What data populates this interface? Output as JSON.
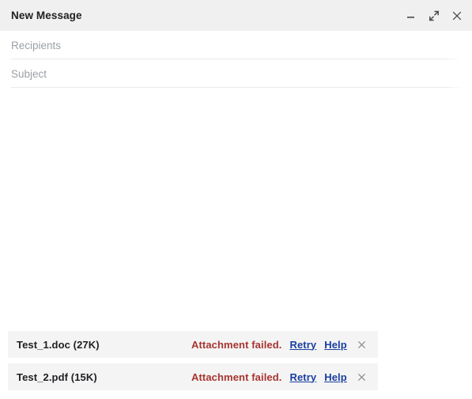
{
  "window": {
    "title": "New Message",
    "controls": [
      {
        "name": "minimize",
        "icon": "minimize-icon",
        "label": "Minimize"
      },
      {
        "name": "popout",
        "icon": "expand-icon",
        "label": "Full screen"
      },
      {
        "name": "close",
        "icon": "close-icon",
        "label": "Save & close"
      }
    ]
  },
  "fields": {
    "recipients": {
      "placeholder": "Recipients",
      "value": ""
    },
    "subject": {
      "placeholder": "Subject",
      "value": ""
    }
  },
  "body": {
    "placeholder": "",
    "value": ""
  },
  "attachments": {
    "items": [
      {
        "filename": "Test_1.doc (27K)",
        "status": "Attachment failed.",
        "retry_label": "Retry",
        "help_label": "Help",
        "remove_icon": "close-icon"
      },
      {
        "filename": "Test_2.pdf (15K)",
        "status": "Attachment failed.",
        "retry_label": "Retry",
        "help_label": "Help",
        "remove_icon": "close-icon"
      }
    ]
  },
  "colors": {
    "header_bg": "#f0f0f0",
    "error_red": "#a8342f",
    "link_blue": "#1a3fa0",
    "attachment_bg": "#f4f4f4",
    "placeholder": "#9aa0a6"
  }
}
